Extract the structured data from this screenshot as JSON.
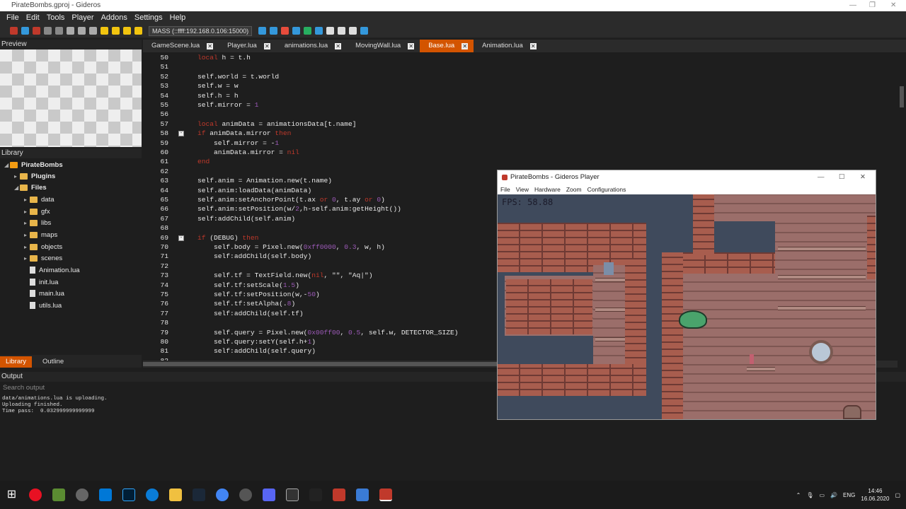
{
  "window": {
    "title": "PirateBombs.gproj - Gideros"
  },
  "menu": [
    "File",
    "Edit",
    "Tools",
    "Player",
    "Addons",
    "Settings",
    "Help"
  ],
  "toolbar": {
    "player_target": "MASS (::ffff:192.168.0.106:15000)"
  },
  "panels": {
    "preview": "Preview",
    "library": "Library",
    "output": "Output",
    "search_output": "Search output"
  },
  "library_tree": [
    {
      "label": "PirateBombs",
      "type": "project",
      "depth": 0
    },
    {
      "label": "Plugins",
      "type": "folder",
      "depth": 1
    },
    {
      "label": "Files",
      "type": "folder",
      "depth": 1
    },
    {
      "label": "data",
      "type": "folder",
      "depth": 2
    },
    {
      "label": "gfx",
      "type": "folder",
      "depth": 2
    },
    {
      "label": "libs",
      "type": "folder",
      "depth": 2
    },
    {
      "label": "maps",
      "type": "folder",
      "depth": 2
    },
    {
      "label": "objects",
      "type": "folder",
      "depth": 2
    },
    {
      "label": "scenes",
      "type": "folder",
      "depth": 2
    },
    {
      "label": "Animation.lua",
      "type": "file",
      "depth": 2
    },
    {
      "label": "init.lua",
      "type": "file",
      "depth": 2
    },
    {
      "label": "main.lua",
      "type": "file",
      "depth": 2
    },
    {
      "label": "utils.lua",
      "type": "file",
      "depth": 2
    }
  ],
  "bottom_tabs": [
    "Library",
    "Outline"
  ],
  "editor_tabs": [
    {
      "label": "GameScene.lua",
      "active": false
    },
    {
      "label": "Player.lua",
      "active": false
    },
    {
      "label": "animations.lua",
      "active": false
    },
    {
      "label": "MovingWall.lua",
      "active": false
    },
    {
      "label": "Base.lua",
      "active": true
    },
    {
      "label": "Animation.lua",
      "active": false
    }
  ],
  "code": [
    {
      "n": "50",
      "t": "local h = t.h"
    },
    {
      "n": "51",
      "t": ""
    },
    {
      "n": "52",
      "t": "self.world = t.world"
    },
    {
      "n": "53",
      "t": "self.w = w"
    },
    {
      "n": "54",
      "t": "self.h = h"
    },
    {
      "n": "55",
      "t": "self.mirror = 1"
    },
    {
      "n": "56",
      "t": ""
    },
    {
      "n": "57",
      "t": "local animData = animationsData[t.name]"
    },
    {
      "n": "58",
      "t": "if animData.mirror then"
    },
    {
      "n": "59",
      "t": "    self.mirror = -1"
    },
    {
      "n": "60",
      "t": "    animData.mirror = nil"
    },
    {
      "n": "61",
      "t": "end"
    },
    {
      "n": "62",
      "t": ""
    },
    {
      "n": "63",
      "t": "self.anim = Animation.new(t.name)"
    },
    {
      "n": "64",
      "t": "self.anim:loadData(animData)"
    },
    {
      "n": "65",
      "t": "self.anim:setAnchorPoint(t.ax or 0, t.ay or 0)"
    },
    {
      "n": "66",
      "t": "self.anim:setPosition(w/2,h-self.anim:getHeight())"
    },
    {
      "n": "67",
      "t": "self:addChild(self.anim)"
    },
    {
      "n": "68",
      "t": ""
    },
    {
      "n": "69",
      "t": "if (DEBUG) then"
    },
    {
      "n": "70",
      "t": "    self.body = Pixel.new(0xff0000, 0.3, w, h)"
    },
    {
      "n": "71",
      "t": "    self:addChild(self.body)"
    },
    {
      "n": "72",
      "t": ""
    },
    {
      "n": "73",
      "t": "    self.tf = TextField.new(nil, \"\", \"Aq|\")"
    },
    {
      "n": "74",
      "t": "    self.tf:setScale(1.5)"
    },
    {
      "n": "75",
      "t": "    self.tf:setPosition(w,-50)"
    },
    {
      "n": "76",
      "t": "    self.tf:setAlpha(.8)"
    },
    {
      "n": "77",
      "t": "    self:addChild(self.tf)"
    },
    {
      "n": "78",
      "t": ""
    },
    {
      "n": "79",
      "t": "    self.query = Pixel.new(0x00ff00, 0.5, self.w, DETECTOR_SIZE)"
    },
    {
      "n": "80",
      "t": "    self.query:setY(self.h+1)"
    },
    {
      "n": "81",
      "t": "    self:addChild(self.query)"
    },
    {
      "n": "82",
      "t": ""
    }
  ],
  "output_lines": "data/animations.lua is uploading.\nUploading finished.\nTime pass:  0.032999999999999",
  "player": {
    "title": "PirateBombs - Gideros Player",
    "menu": [
      "File",
      "View",
      "Hardware",
      "Zoom",
      "Configurations"
    ],
    "fps": "FPS: 58.88"
  },
  "tray": {
    "lang": "ENG",
    "time": "14:46",
    "date": "16.06.2020"
  },
  "colors": {
    "accent_tab": "#d35400",
    "keyword": "#c0392b",
    "number": "#9b59b6"
  }
}
